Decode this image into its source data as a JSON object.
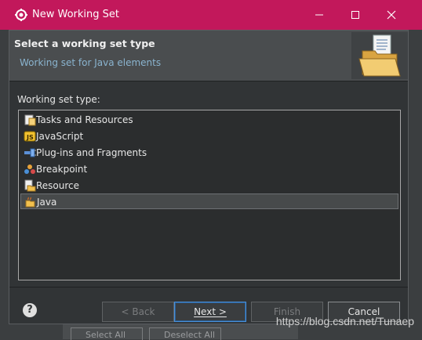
{
  "window": {
    "title": "New Working Set",
    "accent": "#c2185b"
  },
  "banner": {
    "title": "Select a working set type",
    "subtitle": "Working set for Java elements",
    "icon": "folder-document-icon"
  },
  "list": {
    "label": "Working set type:",
    "items": [
      {
        "label": "Tasks and Resources",
        "icon": "tasks-icon",
        "selected": false
      },
      {
        "label": "JavaScript",
        "icon": "javascript-icon",
        "selected": false
      },
      {
        "label": "Plug-ins and Fragments",
        "icon": "plugin-icon",
        "selected": false
      },
      {
        "label": "Breakpoint",
        "icon": "breakpoint-icon",
        "selected": false
      },
      {
        "label": "Resource",
        "icon": "resource-icon",
        "selected": false
      },
      {
        "label": "Java",
        "icon": "java-icon",
        "selected": true
      }
    ]
  },
  "buttons": {
    "back": "< Back",
    "next": "Next >",
    "finish": "Finish",
    "cancel": "Cancel"
  },
  "background": {
    "select_all": "Select All",
    "deselect_all": "Deselect All"
  },
  "watermark": "https://blog.csdn.net/Tunaep"
}
